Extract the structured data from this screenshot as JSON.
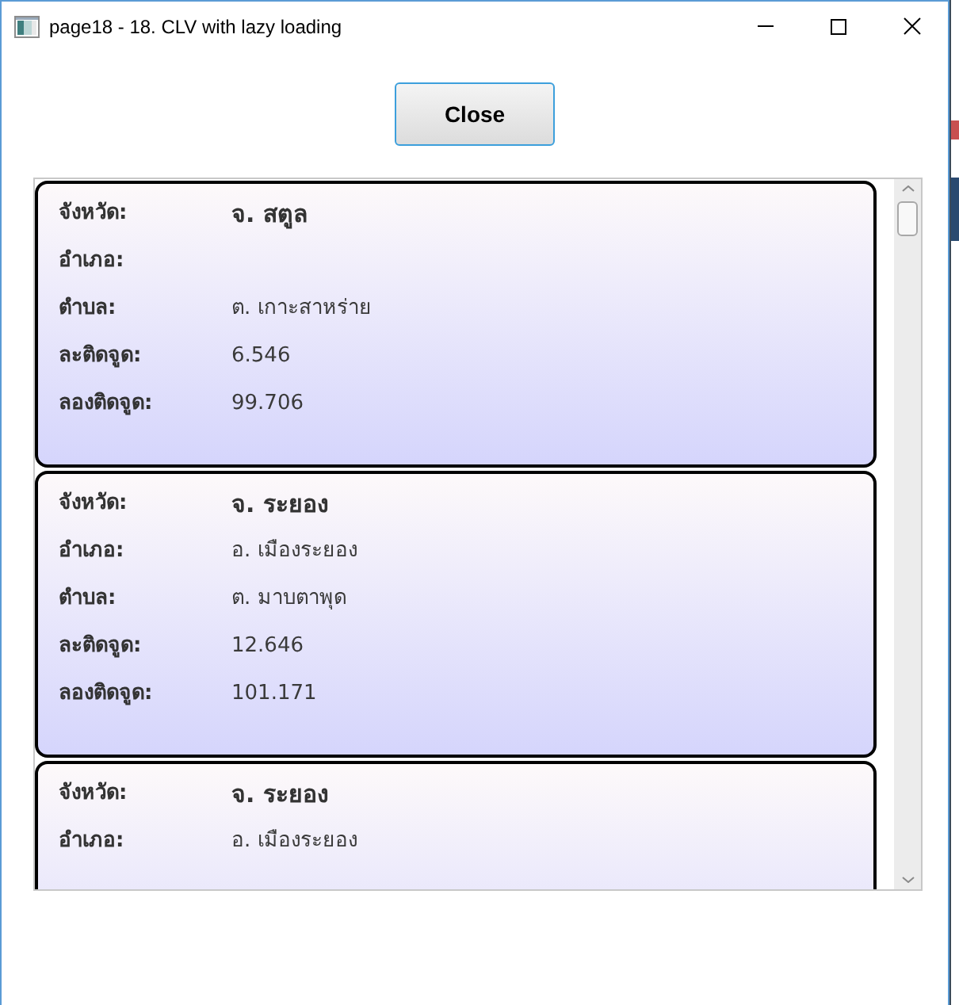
{
  "window": {
    "title": "page18 - 18. CLV with lazy loading"
  },
  "close_button": {
    "label": "Close"
  },
  "list": {
    "items": [
      {
        "fields": [
          {
            "kind": "heading",
            "label": "จังหวัด:",
            "value": "จ. สตูล"
          },
          {
            "kind": "plain",
            "label": "อำเภอ:"
          },
          {
            "kind": "plain",
            "label": "ตำบล:",
            "value": "ต. เกาะสาหร่าย"
          },
          {
            "kind": "plain",
            "label": "ละติดจูด:",
            "value": "6.546"
          },
          {
            "kind": "plain",
            "label": "ลองติดจูด:",
            "value": "99.706"
          }
        ]
      },
      {
        "fields": [
          {
            "kind": "heading",
            "label": "จังหวัด:",
            "value": "จ. ระยอง"
          },
          {
            "kind": "plain",
            "label": "อำเภอ:",
            "value": "อ. เมืองระยอง"
          },
          {
            "kind": "plain",
            "label": "ตำบล:",
            "value": "ต. มาบตาพุด"
          },
          {
            "kind": "plain",
            "label": "ละติดจูด:",
            "value": "12.646"
          },
          {
            "kind": "plain",
            "label": "ลองติดจูด:",
            "value": "101.171"
          }
        ]
      },
      {
        "fields": [
          {
            "kind": "heading",
            "label": "จังหวัด:",
            "value": "จ. ระยอง"
          },
          {
            "kind": "plain",
            "label": "อำเภอ:",
            "value": "อ. เมืองระยอง"
          }
        ]
      }
    ]
  }
}
